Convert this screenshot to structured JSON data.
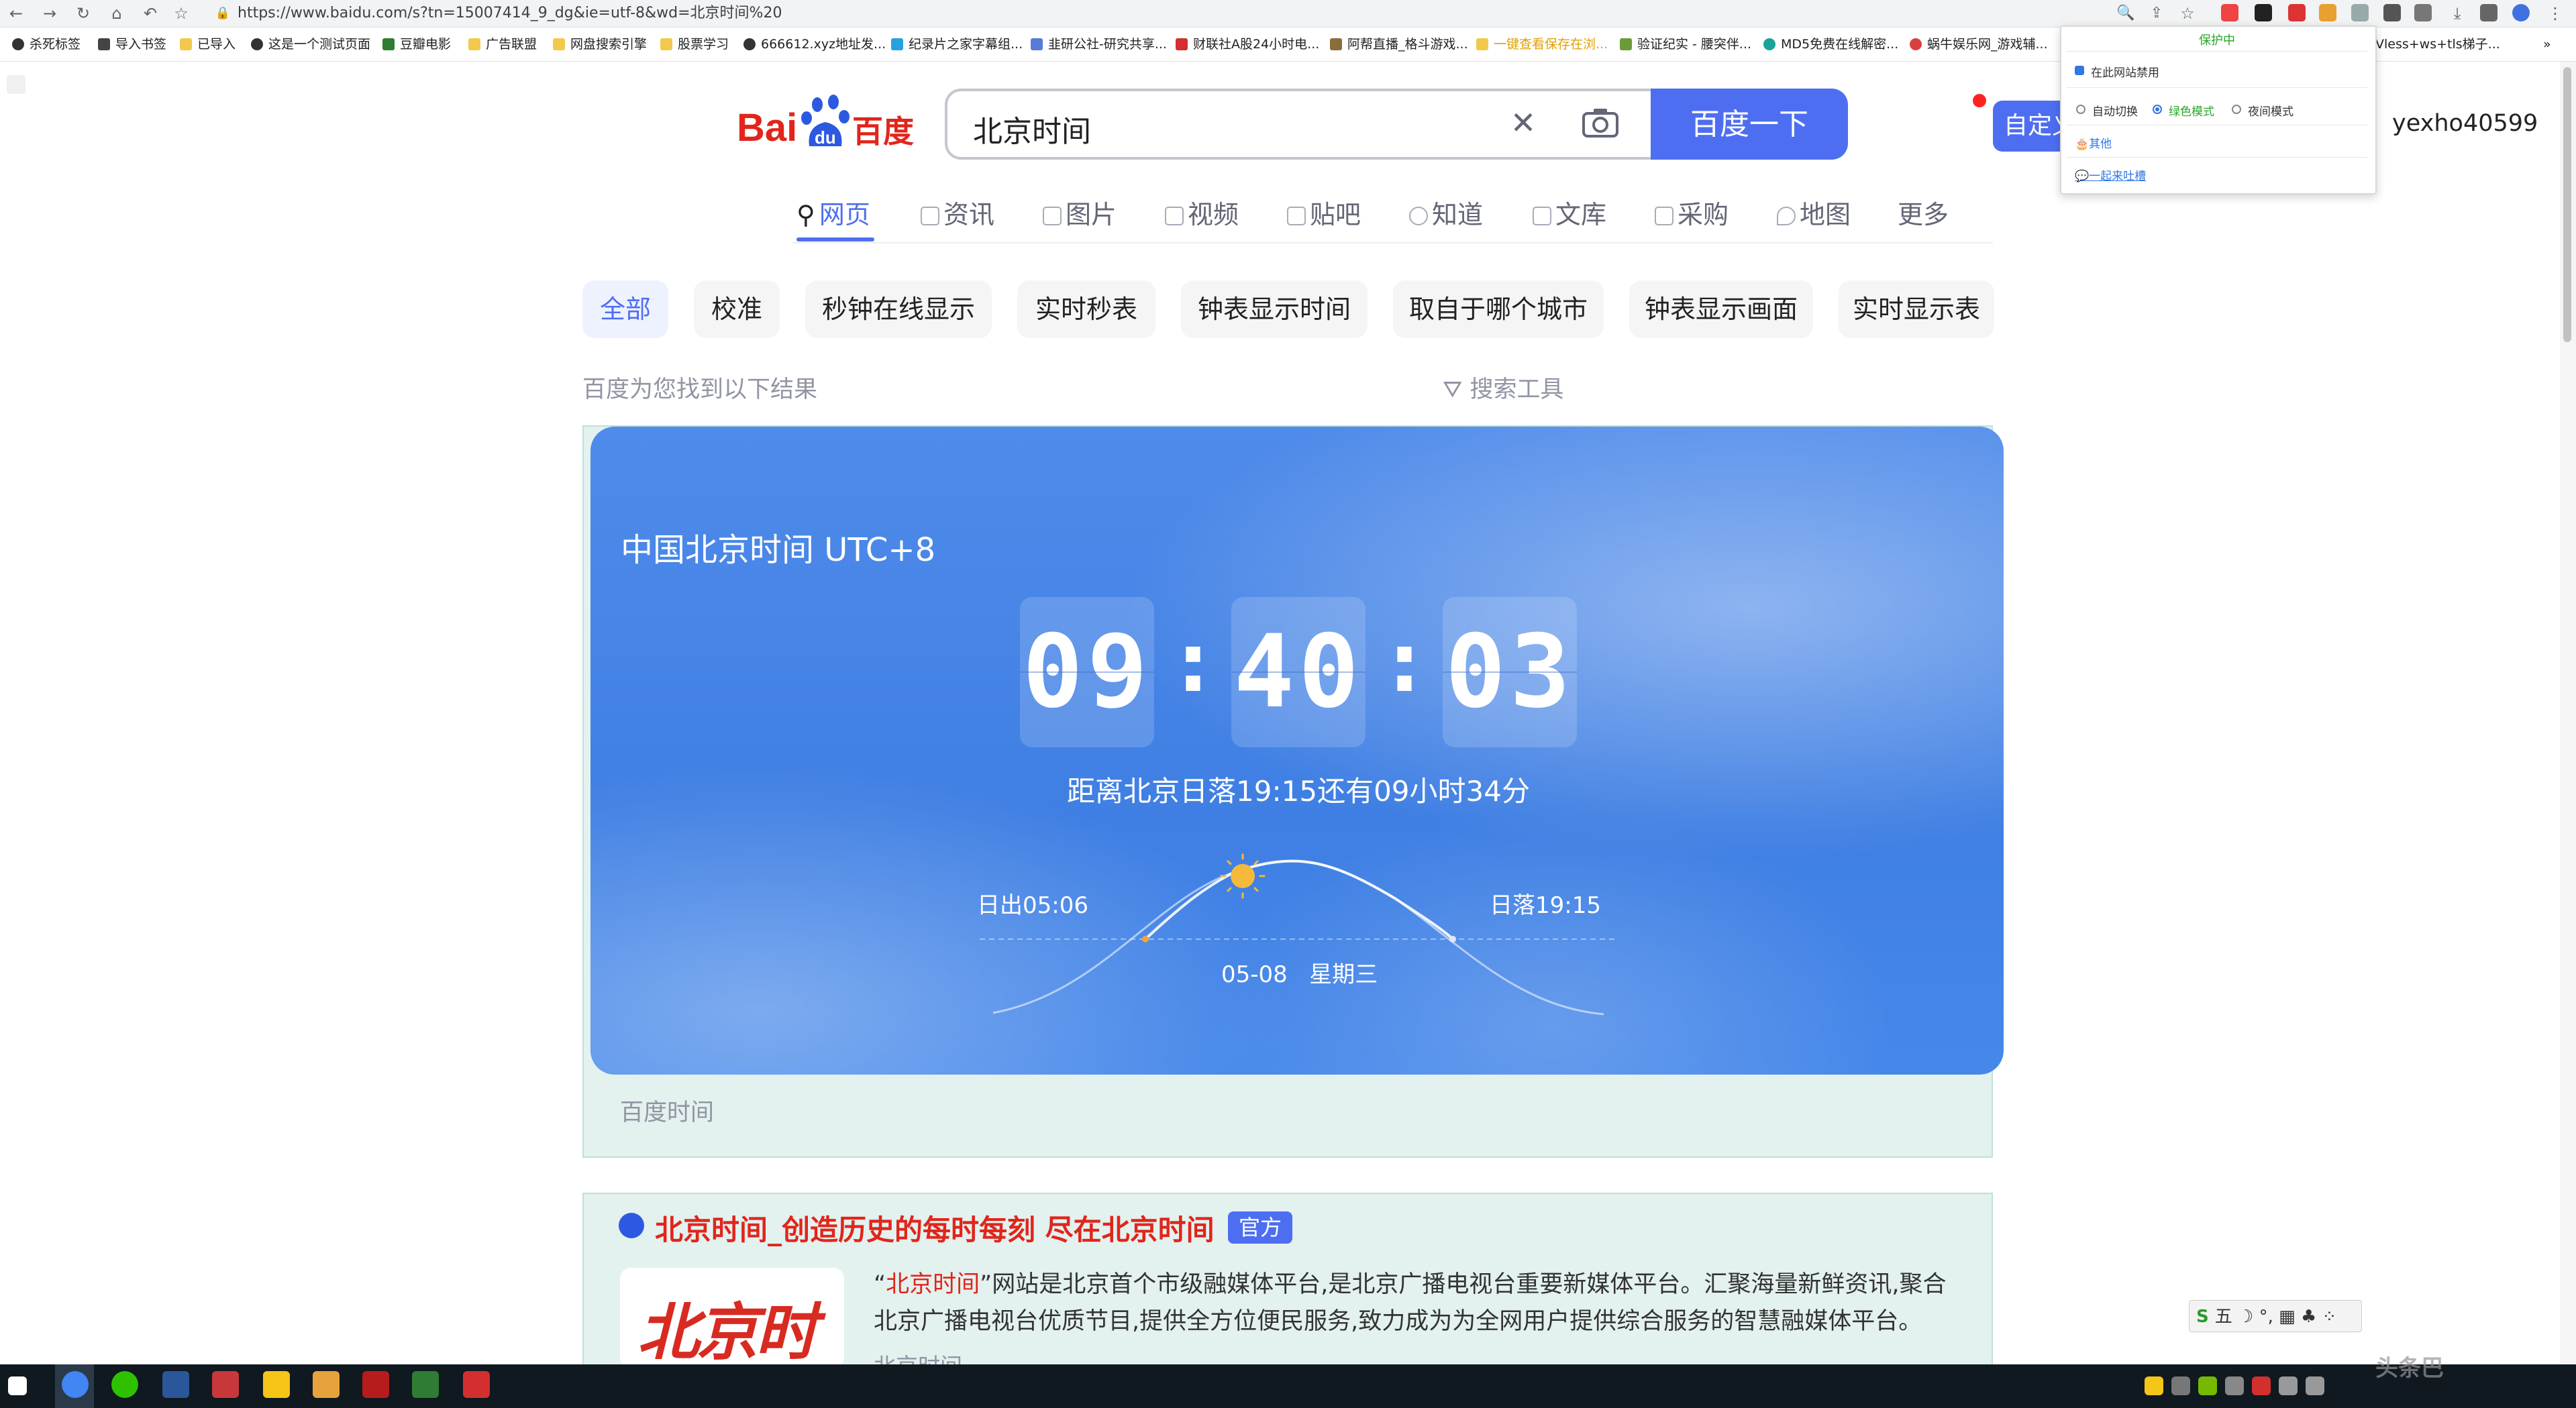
{
  "browser": {
    "url": "https://www.baidu.com/s?tn=15007414_9_dg&ie=utf-8&wd=北京时间%20",
    "bookmarks": [
      "杀死标签",
      "导入书签",
      "已导入",
      "这是一个测试页面",
      "豆瓣电影",
      "广告联盟",
      "网盘搜索引擎",
      "股票学习",
      "666612.xyz地址发...",
      "纪录片之家字幕组...",
      "韭研公社-研究共享...",
      "财联社A股24小时电...",
      "阿帮直播_格斗游戏...",
      "一键查看保存在浏...",
      "验证纪实 - 腰突伴...",
      "MD5免费在线解密...",
      "蜗牛娱乐网_游戏辅...",
      "Vless+ws+tls梯子..."
    ]
  },
  "search": {
    "query": "北京时间",
    "button_label": "百度一下"
  },
  "tabs": [
    {
      "label": "网页",
      "active": true
    },
    {
      "label": "资讯"
    },
    {
      "label": "图片"
    },
    {
      "label": "视频"
    },
    {
      "label": "贴吧"
    },
    {
      "label": "知道"
    },
    {
      "label": "文库"
    },
    {
      "label": "采购"
    },
    {
      "label": "地图"
    },
    {
      "label": "更多"
    }
  ],
  "chips": [
    "全部",
    "校准",
    "秒钟在线显示",
    "实时秒表",
    "钟表显示时间",
    "取自于哪个城市",
    "钟表显示画面",
    "实时显示表"
  ],
  "result_info": "百度为您找到以下结果",
  "search_tools": "搜索工具",
  "time_card": {
    "title": "中国北京时间 UTC+8",
    "hours": "09",
    "minutes": "40",
    "seconds": "03",
    "countdown": "距离北京日落19:15还有09小时34分",
    "sunrise": "日出05:06",
    "sunset": "日落19:15",
    "date": "05-08   星期三",
    "footer": "百度时间"
  },
  "result2": {
    "title": "北京时间_创造历史的每时每刻 尽在北京时间",
    "badge": "官方",
    "desc_highlight": "北京时间",
    "desc_open": "“",
    "desc_close": "”",
    "desc": "网站是北京首个市级融媒体平台,是北京广播电视台重要新媒体平台。汇聚海量新鲜资讯,聚合北京广播电视台优质节目,提供全方位便民服务,致力成为为全网用户提供综合服务的智慧融媒体平台。",
    "more": "北京时间",
    "image_text": "北京时间"
  },
  "user": {
    "name": "yexho40599",
    "custom_label": "自定义"
  },
  "extension_popup": {
    "title": "保护中",
    "disable_on_site": "在此网站禁用",
    "auto_switch": "自动切换",
    "green_mode": "绿色模式",
    "night_mode": "夜间模式",
    "other": "其他",
    "feedback": "一起来吐槽"
  },
  "taskbar": {
    "ime_label": "五 ☽ °, ▦ ♣ ⁘",
    "watermark": "头条巴"
  },
  "colors": {
    "brand_blue": "#4e6ef2",
    "card_blue": "#4688ea",
    "highlight_red": "#e1251b"
  }
}
